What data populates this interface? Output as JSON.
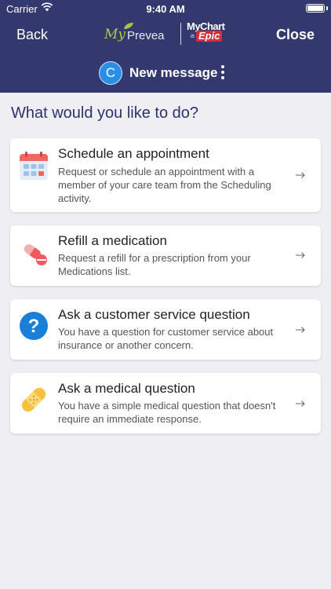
{
  "status_bar": {
    "carrier": "Carrier",
    "time": "9:40 AM"
  },
  "nav": {
    "back_label": "Back",
    "close_label": "Close"
  },
  "logo": {
    "my": "My",
    "prevea": "Prevea",
    "mychart": "MyChart",
    "is": "is",
    "epic": "Epic"
  },
  "message": {
    "avatar_initial": "C",
    "title": "New message"
  },
  "page": {
    "question": "What would you like to do?"
  },
  "options": [
    {
      "title": "Schedule an appointment",
      "description": "Request or schedule an appointment with a member of your care team from the Scheduling activity.",
      "icon": "calendar-icon"
    },
    {
      "title": "Refill a medication",
      "description": "Request a refill for a prescription from your Medications list.",
      "icon": "pill-icon"
    },
    {
      "title": "Ask a customer service question",
      "description": "You have a question for customer service about insurance or another concern.",
      "icon": "question-icon"
    },
    {
      "title": "Ask a medical question",
      "description": "You have a simple medical question that doesn't require an immediate response.",
      "icon": "bandage-icon"
    }
  ],
  "colors": {
    "header": "#33396e",
    "background": "#eeeef3",
    "accent": "#2b8ee6",
    "heading": "#2d326b"
  }
}
